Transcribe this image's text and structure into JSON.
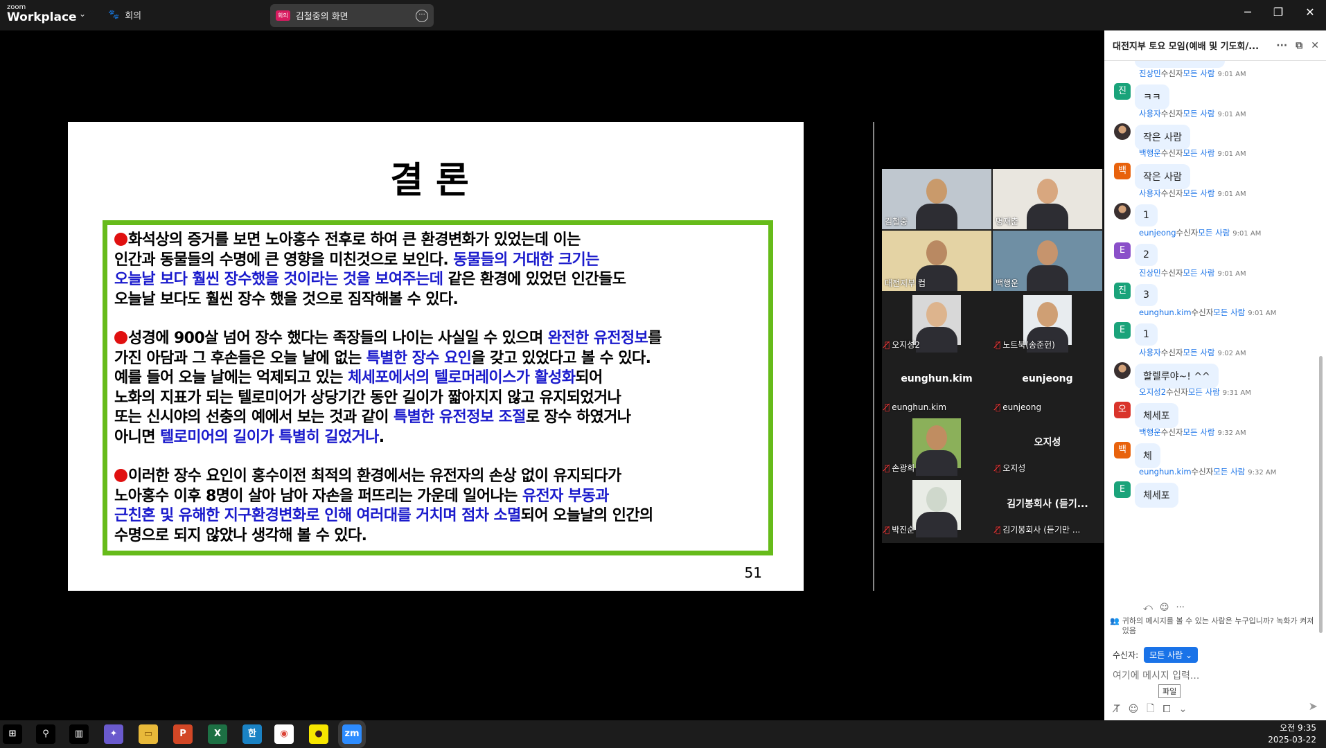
{
  "app": {
    "brand_small": "zoom",
    "brand_big": "Workplace",
    "meeting_menu": "회의",
    "share_tag": "회의",
    "share_label": "김철중의 화면"
  },
  "window": {
    "minimize": "─",
    "restore": "❐",
    "close": "✕"
  },
  "slide": {
    "title": "결론",
    "number": "51",
    "paragraphs": [
      {
        "lines": [
          [
            {
              "t": "화석상의 증거를 보면 노아홍수 전후로 하여 큰 환경변화가  있었는데 이는",
              "b": false
            }
          ],
          [
            {
              "t": "인간과 동물들의 수명에 큰 영향을 미친것으로 보인다. ",
              "b": false
            },
            {
              "t": "동물들의 거대한 크기는",
              "b": true
            }
          ],
          [
            {
              "t": "오늘날 보다 훨씬 장수했을 것이라는 것을 보여주는데",
              "b": true
            },
            {
              "t": " 같은 환경에 있었던 인간들도",
              "b": false
            }
          ],
          [
            {
              "t": "오늘날 보다도 훨씬 장수 했을 것으로 짐작해볼 수 있다.",
              "b": false
            }
          ]
        ]
      },
      {
        "lines": [
          [
            {
              "t": "성경에 900살 넘어 장수 했다는 족장들의 나이는 사실일 수 있으며 ",
              "b": false
            },
            {
              "t": "완전한 유전정보",
              "b": true
            },
            {
              "t": "를",
              "b": false
            }
          ],
          [
            {
              "t": "가진 아담과 그 후손들은 오늘 날에 없는 ",
              "b": false
            },
            {
              "t": "특별한 장수 요인",
              "b": true
            },
            {
              "t": "을 갖고 있었다고 볼 수 있다.",
              "b": false
            }
          ],
          [
            {
              "t": "예를 들어 오늘 날에는 억제되고 있는 ",
              "b": false
            },
            {
              "t": "체세포에서의 텔로머레이스가 활성화",
              "b": true
            },
            {
              "t": "되어",
              "b": false
            }
          ],
          [
            {
              "t": "노화의 지표가 되는 텔로미어가 상당기간 동안 길이가 짧아지지 않고 유지되었거나",
              "b": false
            }
          ],
          [
            {
              "t": "또는 신시야의 선충의 예에서 보는 것과 같이 ",
              "b": false
            },
            {
              "t": "특별한 유전정보 조절",
              "b": true
            },
            {
              "t": "로 장수 하였거나",
              "b": false
            }
          ],
          [
            {
              "t": "아니면 ",
              "b": false
            },
            {
              "t": "텔로미어의 길이가 특별히 길었거나",
              "b": true
            },
            {
              "t": ".",
              "b": false
            }
          ]
        ]
      },
      {
        "lines": [
          [
            {
              "t": "이러한 장수 요인이 홍수이전 최적의 환경에서는 유전자의 손상 없이 유지되다가",
              "b": false
            }
          ],
          [
            {
              "t": "노아홍수 이후 8명이 살아 남아 자손을 퍼뜨리는 가운데 일어나는 ",
              "b": false
            },
            {
              "t": "유전자 부동과",
              "b": true
            }
          ],
          [
            {
              "t": "근친혼 및 유해한 지구환경변화로 인해 여러대를 거치며 점차 소멸",
              "b": true
            },
            {
              "t": "되어 오늘날의 인간의",
              "b": false
            }
          ],
          [
            {
              "t": "수명으로 되지 않았나 생각해 볼 수 있다.",
              "b": false
            }
          ]
        ]
      }
    ]
  },
  "gallery": {
    "tiles": [
      {
        "label": "김철중",
        "muted": false,
        "big": "",
        "video": true,
        "active": true
      },
      {
        "label": "명재춘",
        "muted": false,
        "big": "",
        "video": true,
        "active": false
      },
      {
        "label": "대전지부 컴",
        "muted": false,
        "big": "",
        "video": true,
        "active": false
      },
      {
        "label": "백행운",
        "muted": false,
        "big": "",
        "video": true,
        "active": false
      },
      {
        "label": "오지성2",
        "muted": true,
        "big": "",
        "video": true,
        "active": false
      },
      {
        "label": "노트북(송준헌)",
        "muted": true,
        "big": "",
        "video": true,
        "active": false
      },
      {
        "label": "eunghun.kim",
        "muted": true,
        "big": "eunghun.kim",
        "video": false,
        "active": false
      },
      {
        "label": "eunjeong",
        "muted": true,
        "big": "eunjeong",
        "video": false,
        "active": false
      },
      {
        "label": "손광희",
        "muted": true,
        "big": "",
        "video": true,
        "active": false
      },
      {
        "label": "오지성",
        "muted": true,
        "big": "오지성",
        "video": false,
        "active": false
      },
      {
        "label": "박진순",
        "muted": true,
        "big": "",
        "video": true,
        "active": false
      },
      {
        "label": "김기봉회사 (듣기만 ...",
        "muted": true,
        "big": "김기봉회사 (듣기...",
        "video": false,
        "active": false
      }
    ]
  },
  "chat": {
    "title": "대전지부 토요 모임(예배 및 기도회/...",
    "header_icons": [
      "more-icon",
      "popout-icon",
      "close-icon"
    ],
    "messages": [
      {
        "sender": "진상민",
        "to": "수신자",
        "target": "모든 사람",
        "time": "9:01 AM",
        "text": "ㅋㅋ",
        "avatar": "진",
        "color": "#1aa37a"
      },
      {
        "sender": "사용자",
        "to": "수신자",
        "target": "모든 사람",
        "time": "9:01 AM",
        "text": "작은 사람",
        "avatar": "",
        "color": "#5a4a3a"
      },
      {
        "sender": "백행운",
        "to": "수신자",
        "target": "모든 사람",
        "time": "9:01 AM",
        "text": "작은 사람",
        "avatar": "백",
        "color": "#e8620c"
      },
      {
        "sender": "사용자",
        "to": "수신자",
        "target": "모든 사람",
        "time": "9:01 AM",
        "text": "1",
        "avatar": "",
        "color": "#5a4a3a"
      },
      {
        "sender": "eunjeong",
        "to": "수신자",
        "target": "모든 사람",
        "time": "9:01 AM",
        "text": "2",
        "avatar": "E",
        "color": "#8a4fc9"
      },
      {
        "sender": "진상민",
        "to": "수신자",
        "target": "모든 사람",
        "time": "9:01 AM",
        "text": "3",
        "avatar": "진",
        "color": "#1aa37a"
      },
      {
        "sender": "eunghun.kim",
        "to": "수신자",
        "target": "모든 사람",
        "time": "9:01 AM",
        "text": "1",
        "avatar": "E",
        "color": "#1aa37a"
      },
      {
        "sender": "사용자",
        "to": "수신자",
        "target": "모든 사람",
        "time": "9:02 AM",
        "text": "할렐루야~! ^^",
        "avatar": "",
        "color": "#5a4a3a"
      },
      {
        "sender": "오지성2",
        "to": "수신자",
        "target": "모든 사람",
        "time": "9:31 AM",
        "text": "체세포",
        "avatar": "오",
        "color": "#d9342b"
      },
      {
        "sender": "백행운",
        "to": "수신자",
        "target": "모든 사람",
        "time": "9:32 AM",
        "text": "체",
        "avatar": "백",
        "color": "#e8620c"
      },
      {
        "sender": "eunghun.kim",
        "to": "수신자",
        "target": "모든 사람",
        "time": "9:32 AM",
        "text": "체세포",
        "avatar": "E",
        "color": "#1aa37a"
      }
    ],
    "notice": "귀하의 메시지를 볼 수 있는 사람은 누구입니까? 녹화가 켜져 있음",
    "to_label": "수신자:",
    "to_value": "모든 사람",
    "input_placeholder": "여기에 메시지 입력...",
    "tooltip": "파일"
  },
  "taskbar": {
    "clock_time": "오전 9:35",
    "clock_date": "2025-03-22",
    "apps": [
      "windows-start-icon",
      "search-icon",
      "task-view-icon",
      "copilot-icon",
      "file-explorer-icon",
      "powerpoint-icon",
      "excel-icon",
      "hangul-icon",
      "chrome-icon",
      "kakaotalk-icon",
      "zoom-icon"
    ]
  }
}
